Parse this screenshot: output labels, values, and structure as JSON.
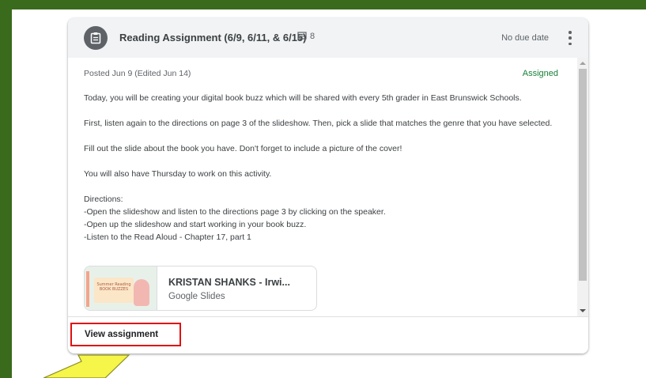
{
  "card": {
    "title": "Reading Assignment (6/9, 6/11, & 6/15)",
    "comment_count": "8",
    "due": "No due date",
    "posted": "Posted Jun 9 (Edited Jun 14)",
    "status": "Assigned",
    "status_color": "#188038",
    "icon": "assignment-icon"
  },
  "description": {
    "p1": "Today, you will be creating your digital book buzz which will be shared with every 5th grader in East Brunswick Schools.",
    "p2": "First, listen again to the directions on page 3 of the slideshow. Then, pick a slide that matches the genre that you have selected.",
    "p3": "Fill out the slide about the book you have. Don't forget to include a picture of the cover!",
    "p4": "You will also have Thursday to work on this activity.",
    "directions_heading": "Directions:",
    "d1": "-Open the slideshow and listen to the directions page 3 by clicking on the speaker.",
    "d2": "-Open up the slideshow and start working in your book buzz.",
    "d3": "-Listen to the Read Aloud - Chapter 17, part 1"
  },
  "attachment": {
    "title": "KRISTAN SHANKS - Irwi...",
    "type": "Google Slides",
    "thumb_text": "Summer Reading BOOK BUZZES"
  },
  "footer": {
    "view_label": "View assignment",
    "highlight_color": "#e01010"
  },
  "annotation": {
    "arrow_color": "#f5f54a"
  }
}
